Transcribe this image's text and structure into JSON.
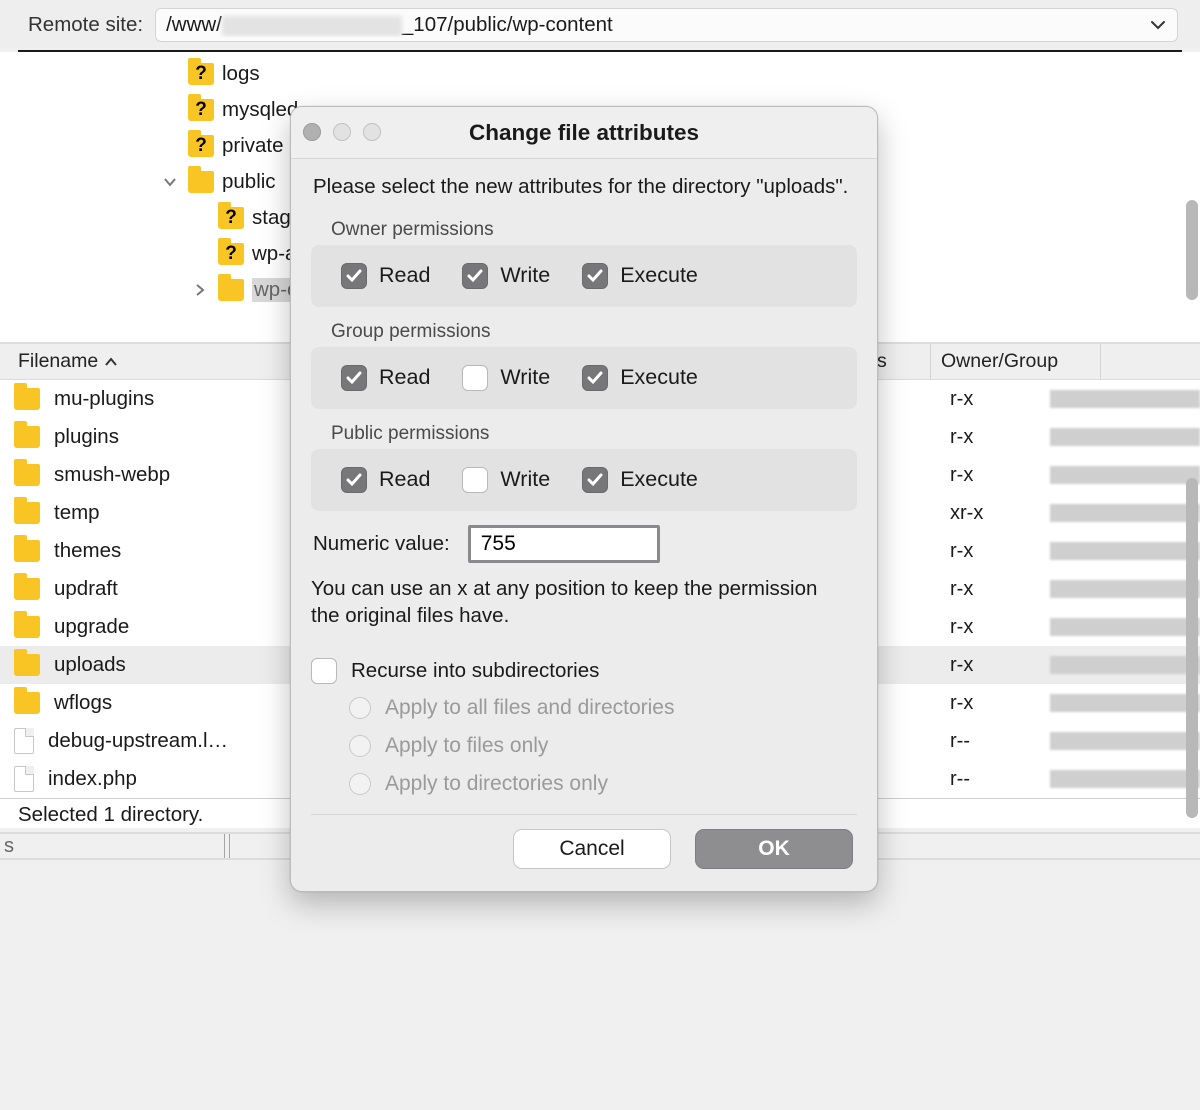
{
  "remote_bar": {
    "label": "Remote site:",
    "path_prefix": "/www/",
    "path_suffix": "_107/public/wp-content"
  },
  "tree": [
    {
      "name": "logs",
      "type": "q",
      "depth": 0
    },
    {
      "name": "mysqled",
      "type": "q",
      "depth": 0
    },
    {
      "name": "private",
      "type": "q",
      "depth": 0
    },
    {
      "name": "public",
      "type": "open",
      "depth": 0,
      "disclosure": "down"
    },
    {
      "name": "stagin",
      "type": "q",
      "depth": 1
    },
    {
      "name": "wp-a",
      "type": "q",
      "depth": 1
    },
    {
      "name": "wp-c",
      "type": "open",
      "depth": 1,
      "disclosure": "right",
      "selected": true
    }
  ],
  "list": {
    "header": {
      "filename": "Filename",
      "permissions": "ions",
      "owner_group": "Owner/Group"
    },
    "rows": [
      {
        "name": "mu-plugins",
        "icon": "folder",
        "perm": "r-x"
      },
      {
        "name": "plugins",
        "icon": "folder",
        "perm": "r-x"
      },
      {
        "name": "smush-webp",
        "icon": "folder",
        "perm": "r-x"
      },
      {
        "name": "temp",
        "icon": "folder",
        "perm": "xr-x"
      },
      {
        "name": "themes",
        "icon": "folder",
        "perm": "r-x"
      },
      {
        "name": "updraft",
        "icon": "folder",
        "perm": "r-x"
      },
      {
        "name": "upgrade",
        "icon": "folder",
        "perm": "r-x"
      },
      {
        "name": "uploads",
        "icon": "folder",
        "perm": "r-x",
        "selected": true
      },
      {
        "name": "wflogs",
        "icon": "folder",
        "perm": "r-x"
      },
      {
        "name": "debug-upstream.l…",
        "icon": "file",
        "perm": "r--"
      },
      {
        "name": "index.php",
        "icon": "file",
        "perm": "r--"
      }
    ],
    "footer": "Selected 1 directory."
  },
  "dialog": {
    "title": "Change file attributes",
    "intro": "Please select the new attributes for the directory \"uploads\".",
    "groups": [
      {
        "label": "Owner permissions",
        "read": true,
        "write": true,
        "execute": true
      },
      {
        "label": "Group permissions",
        "read": true,
        "write": false,
        "execute": true
      },
      {
        "label": "Public permissions",
        "read": true,
        "write": false,
        "execute": true
      }
    ],
    "perm_labels": {
      "read": "Read",
      "write": "Write",
      "execute": "Execute"
    },
    "numeric_label": "Numeric value:",
    "numeric_value": "755",
    "hint": "You can use an x at any position to keep the permission the original files have.",
    "recurse_label": "Recurse into subdirectories",
    "recurse_checked": false,
    "apply_options": [
      "Apply to all files and directories",
      "Apply to files only",
      "Apply to directories only"
    ],
    "buttons": {
      "cancel": "Cancel",
      "ok": "OK"
    }
  }
}
